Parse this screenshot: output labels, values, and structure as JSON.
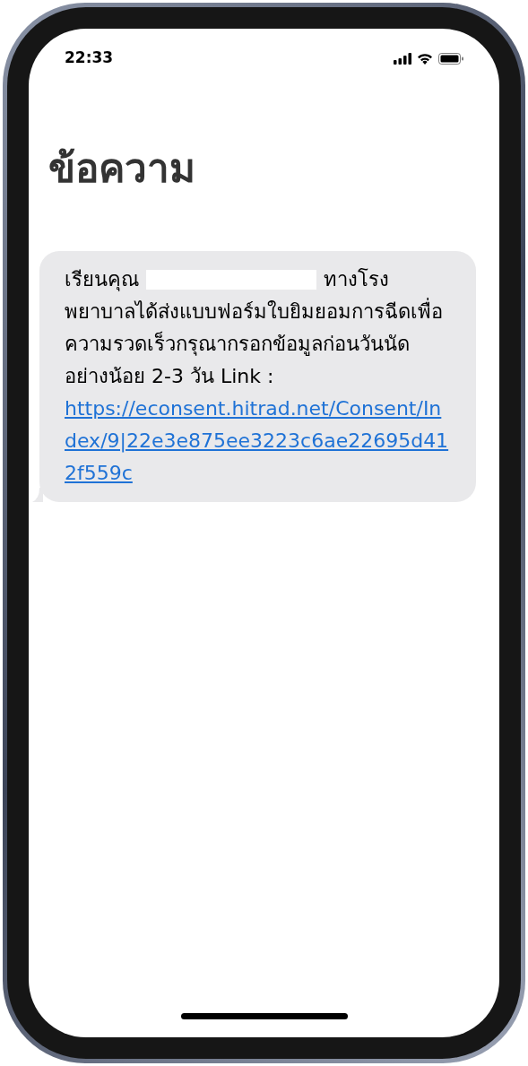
{
  "status_bar": {
    "time": "22:33"
  },
  "title": "ข้อความ",
  "message": {
    "greeting": "เรียนคุณ",
    "name_redacted": true,
    "first_line_end": "ทางโรง",
    "body": "พยาบาลได้ส่งแบบฟอร์มใบยิมยอมการฉีดเพื่อความรวดเร็วกรุณากรอกข้อมูลก่อนวันนัดอย่างน้อย 2-3 วัน Link :",
    "link": "https://econsent.hitrad.net/Consent/Index/9|22e3e875ee3223c6ae22695d412f559c"
  }
}
